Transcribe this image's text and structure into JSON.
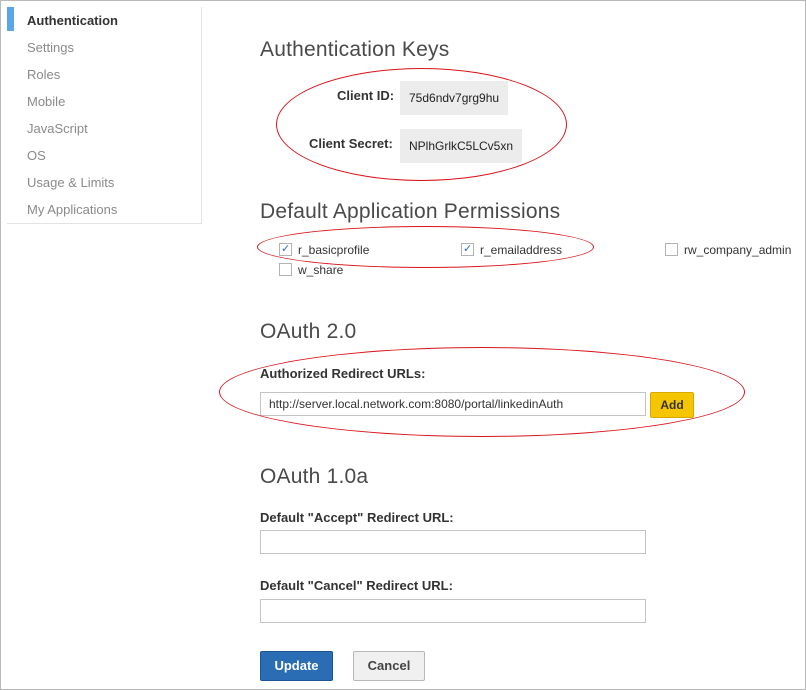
{
  "sidebar": {
    "items": [
      {
        "label": "Authentication",
        "active": true
      },
      {
        "label": "Settings"
      },
      {
        "label": "Roles"
      },
      {
        "label": "Mobile"
      },
      {
        "label": "JavaScript"
      },
      {
        "label": "OS"
      },
      {
        "label": "Usage & Limits"
      },
      {
        "label": "My Applications"
      }
    ]
  },
  "auth_keys": {
    "heading": "Authentication Keys",
    "client_id_label": "Client ID:",
    "client_id_value": "75d6ndv7grg9hu",
    "client_secret_label": "Client Secret:",
    "client_secret_value": "NPlhGrlkC5LCv5xn"
  },
  "permissions": {
    "heading": "Default Application Permissions",
    "items": [
      {
        "label": "r_basicprofile",
        "checked": true
      },
      {
        "label": "r_emailaddress",
        "checked": true
      },
      {
        "label": "rw_company_admin",
        "checked": false
      },
      {
        "label": "w_share",
        "checked": false
      }
    ]
  },
  "oauth2": {
    "heading": "OAuth 2.0",
    "redirect_label": "Authorized Redirect URLs:",
    "redirect_value": "http://server.local.network.com:8080/portal/linkedinAuth",
    "add_label": "Add"
  },
  "oauth1": {
    "heading": "OAuth 1.0a",
    "accept_label": "Default \"Accept\" Redirect URL:",
    "accept_value": "",
    "cancel_label": "Default \"Cancel\" Redirect URL:",
    "cancel_value": ""
  },
  "actions": {
    "update_label": "Update",
    "cancel_label": "Cancel"
  },
  "colors": {
    "accent": "#2a6db5",
    "sidebar_active": "#5aa6e6",
    "annotation": "#d9141a",
    "add_button": "#f5c600"
  }
}
